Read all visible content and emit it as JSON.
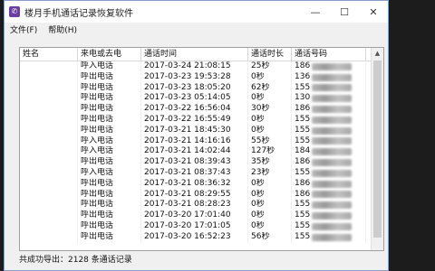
{
  "window": {
    "title": "楼月手机通话记录恢复软件",
    "icon": "phone-app-icon"
  },
  "menu": [
    "文件(F)",
    "帮助(H)"
  ],
  "columns": [
    "姓名",
    "来电或去电",
    "通话时间",
    "通话时长",
    "通话号码"
  ],
  "rows": [
    {
      "name": "",
      "type": "呼入电话",
      "time": "2017-03-24 21:08:15",
      "duration": "25秒",
      "number": "186"
    },
    {
      "name": "",
      "type": "呼出电话",
      "time": "2017-03-23 19:53:28",
      "duration": "0秒",
      "number": "136"
    },
    {
      "name": "",
      "type": "呼出电话",
      "time": "2017-03-23 18:05:20",
      "duration": "62秒",
      "number": "155"
    },
    {
      "name": "",
      "type": "呼出电话",
      "time": "2017-03-23 05:14:05",
      "duration": "0秒",
      "number": "130"
    },
    {
      "name": "",
      "type": "呼出电话",
      "time": "2017-03-22 16:56:04",
      "duration": "30秒",
      "number": "186"
    },
    {
      "name": "",
      "type": "呼出电话",
      "time": "2017-03-22 16:55:49",
      "duration": "0秒",
      "number": "155"
    },
    {
      "name": "",
      "type": "呼出电话",
      "time": "2017-03-21 18:45:30",
      "duration": "0秒",
      "number": "155"
    },
    {
      "name": "",
      "type": "呼入电话",
      "time": "2017-03-21 14:16:16",
      "duration": "55秒",
      "number": "155"
    },
    {
      "name": "",
      "type": "呼入电话",
      "time": "2017-03-21 14:02:44",
      "duration": "127秒",
      "number": "184"
    },
    {
      "name": "",
      "type": "呼出电话",
      "time": "2017-03-21 08:39:43",
      "duration": "35秒",
      "number": "186"
    },
    {
      "name": "",
      "type": "呼入电话",
      "time": "2017-03-21 08:37:43",
      "duration": "23秒",
      "number": "155"
    },
    {
      "name": "",
      "type": "呼出电话",
      "time": "2017-03-21 08:36:32",
      "duration": "0秒",
      "number": "186"
    },
    {
      "name": "",
      "type": "呼出电话",
      "time": "2017-03-21 08:29:55",
      "duration": "0秒",
      "number": "186"
    },
    {
      "name": "",
      "type": "呼出电话",
      "time": "2017-03-21 08:28:23",
      "duration": "0秒",
      "number": "155"
    },
    {
      "name": "",
      "type": "呼出电话",
      "time": "2017-03-20 17:01:40",
      "duration": "0秒",
      "number": "155"
    },
    {
      "name": "",
      "type": "呼出电话",
      "time": "2017-03-20 17:01:05",
      "duration": "0秒",
      "number": "155"
    },
    {
      "name": "",
      "type": "呼出电话",
      "time": "2017-03-20 16:52:23",
      "duration": "56秒",
      "number": "155"
    }
  ],
  "status": "共成功导出：2128 条通话记录"
}
